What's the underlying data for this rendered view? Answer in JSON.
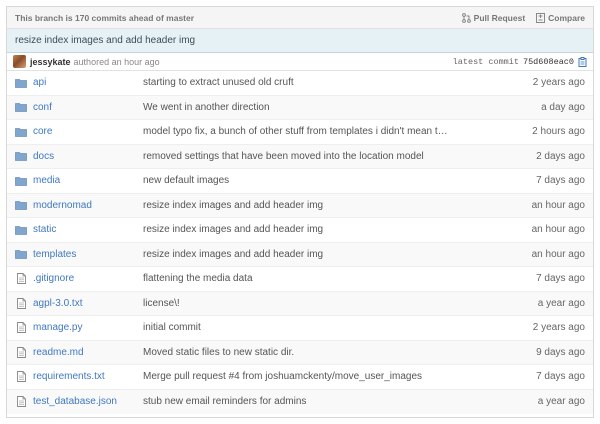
{
  "branch": {
    "status": "This branch is 170 commits ahead of master",
    "pull_request_label": "Pull Request",
    "compare_label": "Compare"
  },
  "commit": {
    "message": "resize index images and add header img",
    "author": "jessykate",
    "authored_text": "authored an hour ago",
    "latest_label": "latest commit",
    "sha": "75d608eac0"
  },
  "files": [
    {
      "type": "folder",
      "name": "api",
      "message": "starting to extract unused old cruft",
      "age": "2 years ago"
    },
    {
      "type": "folder",
      "name": "conf",
      "message": "We went in another direction",
      "age": "a day ago"
    },
    {
      "type": "folder",
      "name": "core",
      "message": "model typo fix, a bunch of other stuff from templates i didn't mean t…",
      "age": "2 hours ago"
    },
    {
      "type": "folder",
      "name": "docs",
      "message": "removed settings that have been moved into the location model",
      "age": "2 days ago"
    },
    {
      "type": "folder",
      "name": "media",
      "message": "new default images",
      "age": "7 days ago"
    },
    {
      "type": "folder",
      "name": "modernomad",
      "message": "resize index images and add header img",
      "age": "an hour ago"
    },
    {
      "type": "folder",
      "name": "static",
      "message": "resize index images and add header img",
      "age": "an hour ago"
    },
    {
      "type": "folder",
      "name": "templates",
      "message": "resize index images and add header img",
      "age": "an hour ago"
    },
    {
      "type": "file",
      "name": ".gitignore",
      "message": "flattening the media data",
      "age": "7 days ago"
    },
    {
      "type": "file",
      "name": "agpl-3.0.txt",
      "message": "license\\!",
      "age": "a year ago"
    },
    {
      "type": "file",
      "name": "manage.py",
      "message": "initial commit",
      "age": "2 years ago"
    },
    {
      "type": "file",
      "name": "readme.md",
      "message": "Moved static files to new static dir.",
      "age": "9 days ago"
    },
    {
      "type": "file",
      "name": "requirements.txt",
      "message": "Merge pull request #4 from joshuamckenty/move_user_images",
      "age": "7 days ago"
    },
    {
      "type": "file",
      "name": "test_database.json",
      "message": "stub new email reminders for admins",
      "age": "a year ago"
    }
  ],
  "icons": {
    "folder": "folder-icon",
    "file": "file-icon",
    "pull_request": "pull-request-icon",
    "compare": "compare-icon",
    "copy": "clipboard-icon"
  },
  "colors": {
    "link": "#4078c0",
    "folder": "#80a6cd",
    "commit_bar_bg": "#e6f1f6"
  }
}
